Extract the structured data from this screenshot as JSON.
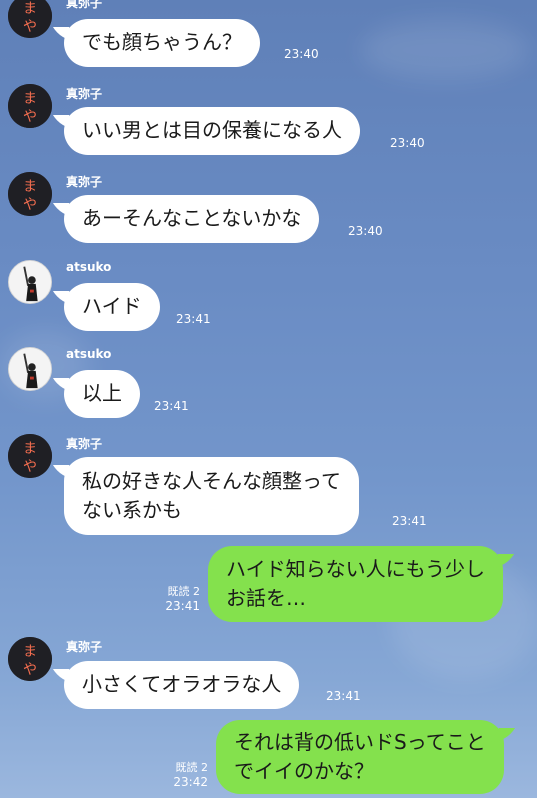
{
  "contacts": {
    "maya": {
      "name": "真弥子",
      "avatar_text_top": "ま",
      "avatar_text_bottom": "や",
      "avatar_text_color": "#f36d4f"
    },
    "atsuko": {
      "name": "atsuko"
    }
  },
  "messages": [
    {
      "sender": "maya",
      "text": "でも顔ちゃうん？",
      "time": "23:40"
    },
    {
      "sender": "maya",
      "text": "いい男とは目の保養になる人",
      "time": "23:40"
    },
    {
      "sender": "maya",
      "text": "あーそんなことないかな",
      "time": "23:40"
    },
    {
      "sender": "atsuko",
      "text": "ハイド",
      "time": "23:41"
    },
    {
      "sender": "atsuko",
      "text": "以上",
      "time": "23:41"
    },
    {
      "sender": "maya",
      "text": "私の好きな人そんな顔整って\nない系かも",
      "time": "23:41"
    },
    {
      "sender": "me",
      "text": "ハイド知らない人にもう少し\nお話を…",
      "read": "既読 2",
      "time": "23:41"
    },
    {
      "sender": "maya",
      "text": "小さくてオラオラな人",
      "time": "23:41"
    },
    {
      "sender": "me",
      "text": "それは背の低いドSってこと\nでイイのかな？",
      "read": "既読 2",
      "time": "23:42"
    }
  ],
  "colors": {
    "incoming_bubble": "#ffffff",
    "outgoing_bubble": "#84e14d",
    "background": "#6a8cc4"
  }
}
